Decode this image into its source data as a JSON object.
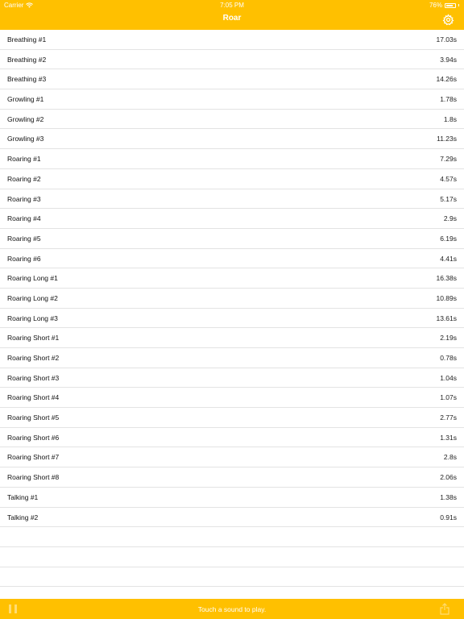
{
  "status_bar": {
    "carrier": "Carrier",
    "time": "7:05 PM",
    "battery": "76%",
    "battery_level": 0.76
  },
  "nav": {
    "title": "Roar",
    "settings_icon": "gear-icon"
  },
  "sounds": [
    {
      "name": "Breathing #1",
      "duration": "17.03s"
    },
    {
      "name": "Breathing #2",
      "duration": "3.94s"
    },
    {
      "name": "Breathing #3",
      "duration": "14.26s"
    },
    {
      "name": "Growling #1",
      "duration": "1.78s"
    },
    {
      "name": "Growling #2",
      "duration": "1.8s"
    },
    {
      "name": "Growling #3",
      "duration": "11.23s"
    },
    {
      "name": "Roaring #1",
      "duration": "7.29s"
    },
    {
      "name": "Roaring #2",
      "duration": "4.57s"
    },
    {
      "name": "Roaring #3",
      "duration": "5.17s"
    },
    {
      "name": "Roaring #4",
      "duration": "2.9s"
    },
    {
      "name": "Roaring #5",
      "duration": "6.19s"
    },
    {
      "name": "Roaring #6",
      "duration": "4.41s"
    },
    {
      "name": "Roaring Long #1",
      "duration": "16.38s"
    },
    {
      "name": "Roaring Long #2",
      "duration": "10.89s"
    },
    {
      "name": "Roaring Long #3",
      "duration": "13.61s"
    },
    {
      "name": "Roaring Short #1",
      "duration": "2.19s"
    },
    {
      "name": "Roaring Short #2",
      "duration": "0.78s"
    },
    {
      "name": "Roaring Short #3",
      "duration": "1.04s"
    },
    {
      "name": "Roaring Short #4",
      "duration": "1.07s"
    },
    {
      "name": "Roaring Short #5",
      "duration": "2.77s"
    },
    {
      "name": "Roaring Short #6",
      "duration": "1.31s"
    },
    {
      "name": "Roaring Short #7",
      "duration": "2.8s"
    },
    {
      "name": "Roaring Short #8",
      "duration": "2.06s"
    },
    {
      "name": "Talking #1",
      "duration": "1.38s"
    },
    {
      "name": "Talking #2",
      "duration": "0.91s"
    }
  ],
  "toolbar": {
    "message": "Touch a sound to play.",
    "pause_icon": "pause-icon",
    "share_icon": "share-icon"
  },
  "colors": {
    "accent": "#ffc000",
    "bar_text": "#ffffff",
    "separator": "#e3e3e3"
  }
}
